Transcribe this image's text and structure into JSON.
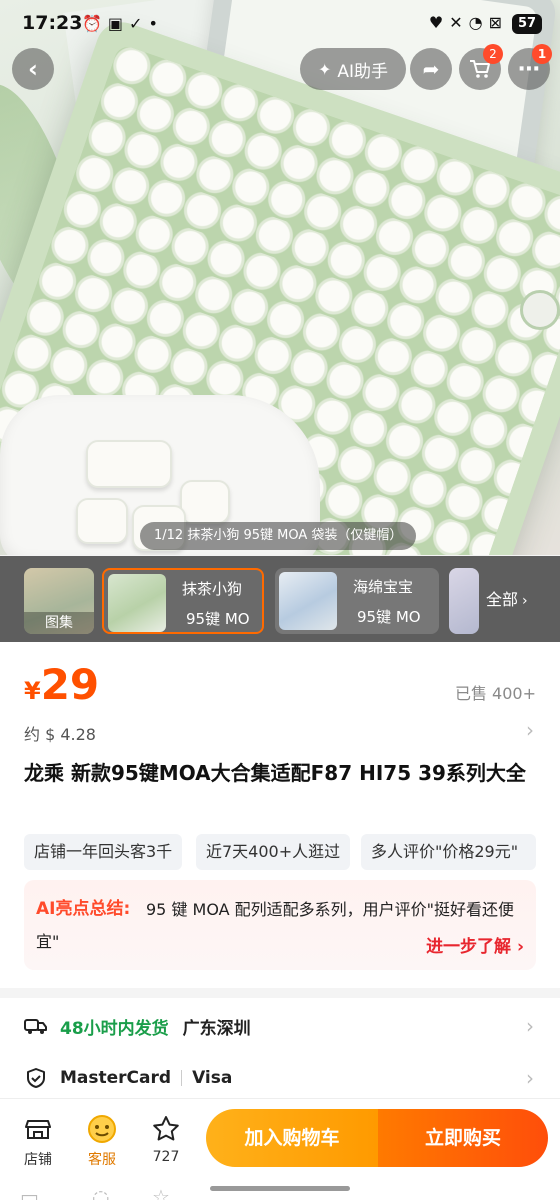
{
  "status_bar": {
    "time": "17:23",
    "battery": "57",
    "left_icons": [
      "alarm-icon",
      "screen-capture-icon",
      "checkmark-icon",
      "dot"
    ],
    "right_icons": [
      "heart-icon",
      "mute-icon",
      "wifi-icon",
      "close-icon"
    ]
  },
  "top_nav": {
    "back_icon": "chevron-left-icon",
    "ai_label": "AI助手",
    "share_icon": "share-icon",
    "cart_icon": "cart-icon",
    "cart_badge": "2",
    "more_icon": "more-icon",
    "more_badge": "1"
  },
  "hero": {
    "counter": "1/12 抹茶小狗 95键 MOA 袋装（仅键帽）"
  },
  "sku_strip": {
    "gallery_label": "图集",
    "options": [
      {
        "line1": "抹茶小狗",
        "line2": "95键 MO",
        "selected": true
      },
      {
        "line1": "海绵宝宝",
        "line2": "95键 MO",
        "selected": false
      }
    ],
    "all_label": "全部",
    "all_icon": "chevron-right-icon"
  },
  "product": {
    "currency": "¥",
    "price": "29",
    "sold": "已售 400+",
    "approx_usd": "约 $ 4.28",
    "title": "龙乘 新款95键MOA大合集适配F87 HI75 39系列大全",
    "tags": [
      "店铺一年回头客3千",
      "近7天400+人逛过",
      "多人评价\"价格29元\""
    ],
    "ai_summary_label": "AI亮点总结:",
    "ai_summary_text": "95 键 MOA 配列适配多系列，用户评价\"挺好看还便宜\"",
    "ai_more": "进一步了解",
    "accent_color": "#ff5000"
  },
  "shipping": {
    "ship_icon": "truck-icon",
    "ship_time": "48小时内发货",
    "location": "广东深圳",
    "pay_icon": "shield-check-icon",
    "pay_methods": [
      "MasterCard",
      "Visa"
    ]
  },
  "bottom_bar": {
    "store_label": "店铺",
    "service_label": "客服",
    "fav_count": "727",
    "add_to_cart": "加入购物车",
    "buy_now": "立即购买"
  }
}
